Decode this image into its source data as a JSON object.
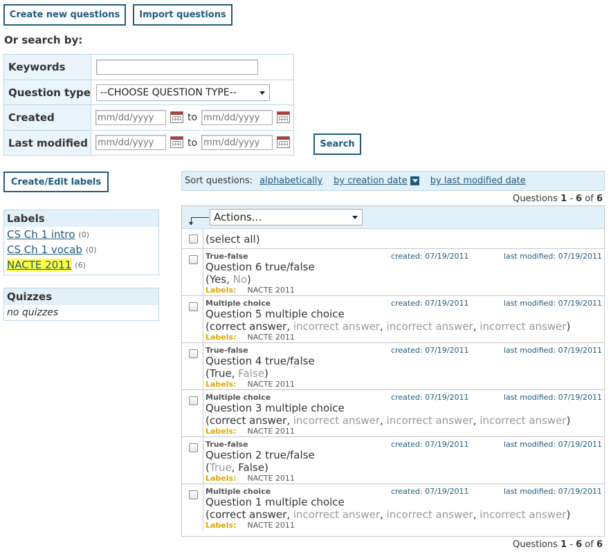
{
  "toolbar": {
    "create_new": "Create new questions",
    "import": "Import questions"
  },
  "search": {
    "heading": "Or search by:",
    "keywords_label": "Keywords",
    "keywords_value": "",
    "question_type_label": "Question type",
    "question_type_selected": "--CHOOSE QUESTION TYPE--",
    "created_label": "Created",
    "last_modified_label": "Last modified",
    "date_placeholder": "mm/dd/yyyy",
    "to_word": "to",
    "search_button": "Search"
  },
  "labels_button": "Create/Edit labels",
  "labels_panel": {
    "heading": "Labels",
    "items": [
      {
        "name": "CS Ch 1 intro",
        "count": "(0)"
      },
      {
        "name": "CS Ch 1 vocab",
        "count": "(0)"
      },
      {
        "name": "NACTE 2011",
        "count": "(6)"
      }
    ]
  },
  "quizzes_panel": {
    "heading": "Quizzes",
    "empty_text": "no quizzes"
  },
  "sort": {
    "prefix": "Sort questions:",
    "alphabetically": "alphabetically",
    "by_creation_date": "by creation date",
    "by_last_modified": "by last modified date"
  },
  "count": {
    "prefix": "Questions",
    "start": "1",
    "sep": "-",
    "end": "6",
    "of": "of",
    "total": "6"
  },
  "actions": {
    "selected": "Actions...",
    "select_all": "(select all)"
  },
  "questions": [
    {
      "type": "True-false",
      "created": "created: 07/19/2011",
      "modified": "last modified: 07/19/2011",
      "title": "Question 6 true/false",
      "answers": [
        {
          "text": "Yes",
          "correct": true
        },
        {
          "text": "No",
          "correct": false
        }
      ],
      "labels_key": "Labels:",
      "labels_val": "NACTE 2011"
    },
    {
      "type": "Multiple choice",
      "created": "created: 07/19/2011",
      "modified": "last modified: 07/19/2011",
      "title": "Question 5 multiple choice",
      "answers": [
        {
          "text": "correct answer",
          "correct": true
        },
        {
          "text": "incorrect answer",
          "correct": false
        },
        {
          "text": "incorrect answer",
          "correct": false
        },
        {
          "text": "incorrect answer",
          "correct": false
        }
      ],
      "labels_key": "Labels:",
      "labels_val": "NACTE 2011"
    },
    {
      "type": "True-false",
      "created": "created: 07/19/2011",
      "modified": "last modified: 07/19/2011",
      "title": "Question 4 true/false",
      "answers": [
        {
          "text": "True",
          "correct": true
        },
        {
          "text": "False",
          "correct": false
        }
      ],
      "labels_key": "Labels:",
      "labels_val": "NACTE 2011"
    },
    {
      "type": "Multiple choice",
      "created": "created: 07/19/2011",
      "modified": "last modified: 07/19/2011",
      "title": "Question 3 multiple choice",
      "answers": [
        {
          "text": "correct answer",
          "correct": true
        },
        {
          "text": "incorrect answer",
          "correct": false
        },
        {
          "text": "incorrect answer",
          "correct": false
        },
        {
          "text": "incorrect answer",
          "correct": false
        }
      ],
      "labels_key": "Labels:",
      "labels_val": "NACTE 2011"
    },
    {
      "type": "True-false",
      "created": "created: 07/19/2011",
      "modified": "last modified: 07/19/2011",
      "title": "Question 2 true/false",
      "answers": [
        {
          "text": "True",
          "correct": false
        },
        {
          "text": "False",
          "correct": true
        }
      ],
      "labels_key": "Labels:",
      "labels_val": "NACTE 2011"
    },
    {
      "type": "Multiple choice",
      "created": "created: 07/19/2011",
      "modified": "last modified: 07/19/2011",
      "title": "Question 1 multiple choice",
      "answers": [
        {
          "text": "correct answer",
          "correct": true
        },
        {
          "text": "incorrect answer",
          "correct": false
        },
        {
          "text": "incorrect answer",
          "correct": false
        },
        {
          "text": "incorrect answer",
          "correct": false
        }
      ],
      "labels_key": "Labels:",
      "labels_val": "NACTE 2011"
    }
  ],
  "colors": {
    "accent": "#1f5a7c",
    "panel_bg": "#e2f0f9",
    "highlight": "#ffff44",
    "labels_key": "#e0a800"
  },
  "icons": {
    "calendar": "calendar-icon",
    "dropdown": "chevron-down-icon",
    "sort_indicator": "sort-desc-icon"
  }
}
